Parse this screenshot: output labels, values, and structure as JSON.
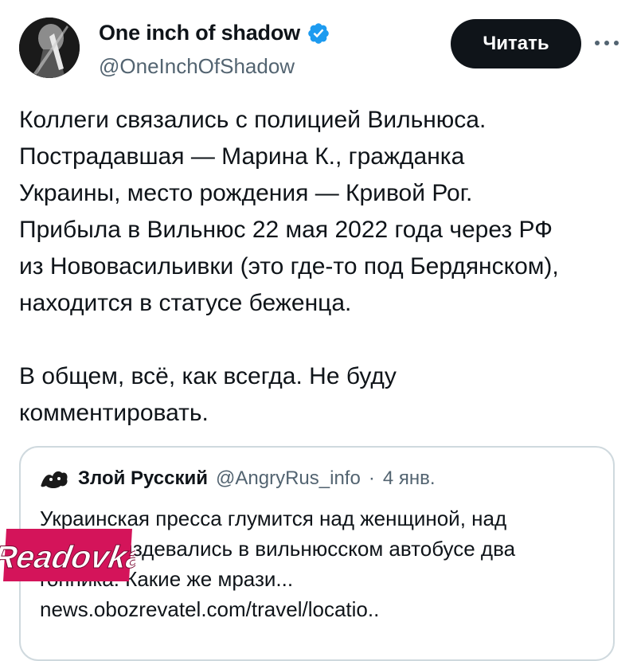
{
  "tweet": {
    "author": {
      "display_name": "One inch of shadow",
      "handle": "@OneInchOfShadow",
      "verified": true
    },
    "follow_label": "Читать",
    "more_icon": "more-horizontal-icon",
    "body_lines_1": [
      "Коллеги связались с полицией Вильнюса.",
      "Пострадавшая — Марина К., гражданка",
      "Украины, место рождения — Кривой Рог.",
      "Прибыла в Вильнюс 22 мая 2022 года через РФ",
      "из Нововасильивки (это где-то под Бердянском),",
      "находится в статусе беженца."
    ],
    "body_lines_2": [
      "В общем, всё, как всегда. Не буду",
      "комментировать."
    ]
  },
  "quote": {
    "author": {
      "display_name": "Злой Русский",
      "handle": "@AngryRus_info"
    },
    "separator": "·",
    "date": "4 янв.",
    "lines": [
      "Украинская пресса глумится над женщиной, над",
      "которой издевались в вильнюсском автобусе два",
      "гопника. Какие же мрази...",
      "news.obozrevatel.com/travel/locatio.."
    ]
  },
  "watermark": {
    "text": "Readovka",
    "color_fill": "#d4145a",
    "color_outline": "#ffffff"
  },
  "colors": {
    "verified_badge": "#1d9bf0",
    "follow_button_bg": "#0f1419",
    "secondary_text": "#536471",
    "card_border": "#cfd9de"
  }
}
